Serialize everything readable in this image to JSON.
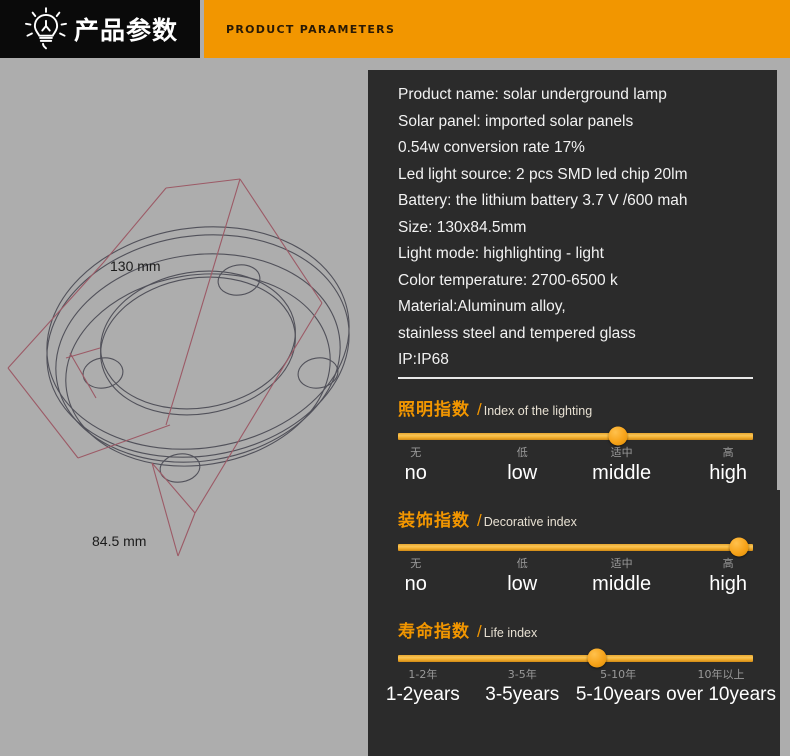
{
  "header": {
    "icon": "lightbulb-icon",
    "title_cn": "产品参数",
    "title_en": "PRODUCT PARAMETERS",
    "black_bg": "#0A0A0A",
    "orange_bg": "#F29600"
  },
  "drawing": {
    "name": "solar-underground-lamp-cad-drawing",
    "dimension_width": "130 mm",
    "dimension_height": "84.5 mm",
    "line_color": "#4a4a52",
    "dim_line_color": "#9c5a66"
  },
  "specs": [
    "Product name: solar underground lamp",
    "Solar panel: imported solar panels",
    "0.54w conversion rate 17%",
    "Led light source: 2 pcs SMD led chip 20lm",
    "Battery: the lithium battery 3.7 V /600 mah",
    "Size: 130x84.5mm",
    "Light mode: highlighting - light",
    "Color temperature: 2700-6500 k",
    "Material:Aluminum alloy,",
    "stainless steel and tempered glass",
    "IP:IP68"
  ],
  "indexes": [
    {
      "title_cn": "照明指数",
      "slash": "/",
      "title_en": "Index of the lighting",
      "value_percent": 62,
      "ticks_cn": [
        "无",
        "低",
        "适中",
        "高"
      ],
      "ticks_en": [
        "no",
        "low",
        "middle",
        "high"
      ],
      "tick_positions": [
        5,
        35,
        63,
        93
      ]
    },
    {
      "title_cn": "装饰指数",
      "slash": "/",
      "title_en": "Decorative index",
      "value_percent": 96,
      "ticks_cn": [
        "无",
        "低",
        "适中",
        "高"
      ],
      "ticks_en": [
        "no",
        "low",
        "middle",
        "high"
      ],
      "tick_positions": [
        5,
        35,
        63,
        93
      ]
    },
    {
      "title_cn": "寿命指数",
      "slash": "/",
      "title_en": "Life index",
      "value_percent": 56,
      "ticks_cn": [
        "1-2年",
        "3-5年",
        "5-10年",
        "10年以上"
      ],
      "ticks_en": [
        "1-2years",
        "3-5years",
        "5-10years",
        "over 10years"
      ],
      "tick_positions": [
        7,
        35,
        62,
        91
      ]
    }
  ],
  "colors": {
    "page_bg": "#ADADAD",
    "panel_bg": "#2B2B2B",
    "accent": "#F29600",
    "text_light": "#F2F2F2"
  }
}
